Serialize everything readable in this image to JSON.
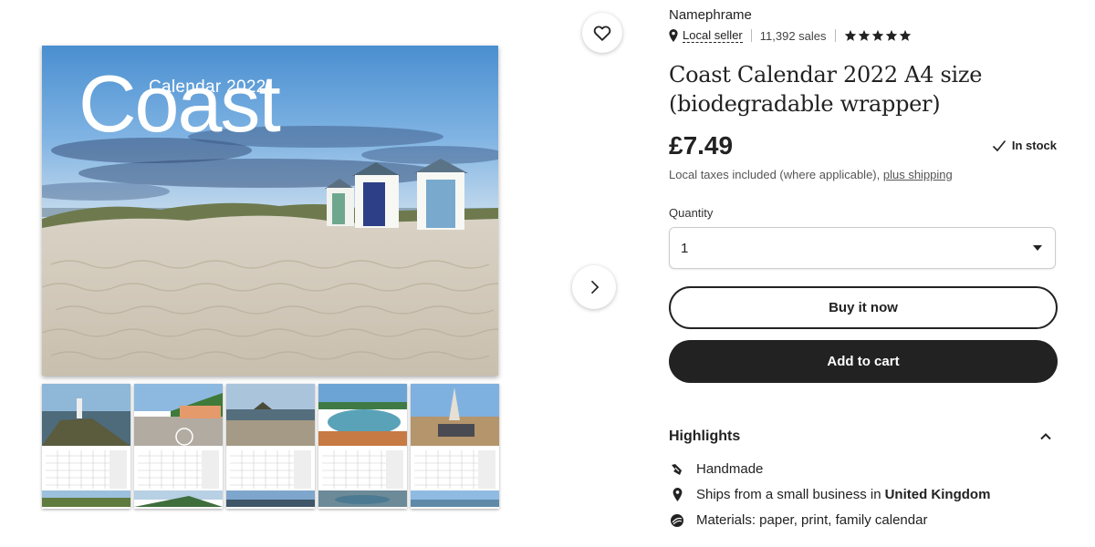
{
  "gallery": {
    "main_image": {
      "title_small": "Calendar 2022",
      "title_big": "Coast"
    },
    "thumbnails_count": 5,
    "favorite_icon": "heart-icon",
    "next_icon": "chevron-right-icon"
  },
  "shop": {
    "name": "Namephrame",
    "location_icon": "map-pin-icon",
    "local_seller": "Local seller",
    "sales": "11,392 sales",
    "rating_stars": 5
  },
  "product": {
    "title": "Coast Calendar 2022 A4 size (biodegradable wrapper)",
    "price": "£7.49",
    "stock_status": "In stock",
    "taxes_note": "Local taxes included (where applicable), ",
    "shipping_link": "plus shipping"
  },
  "quantity": {
    "label": "Quantity",
    "selected": "1"
  },
  "actions": {
    "buy_now": "Buy it now",
    "add_to_cart": "Add to cart"
  },
  "highlights": {
    "title": "Highlights",
    "items": [
      {
        "icon": "handmade-icon",
        "text": "Handmade"
      },
      {
        "icon": "location-pin-icon",
        "text_prefix": "Ships from a small business in ",
        "text_bold": "United Kingdom"
      },
      {
        "icon": "materials-icon",
        "text": "Materials: paper, print, family calendar"
      }
    ]
  }
}
